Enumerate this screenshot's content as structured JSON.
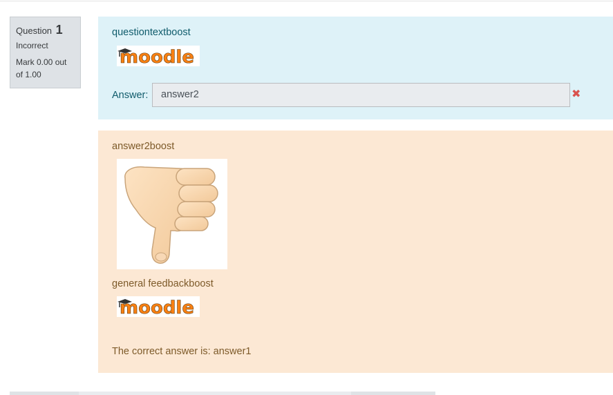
{
  "info": {
    "question_label": "Question",
    "question_number": "1",
    "state": "Incorrect",
    "grade": "Mark 0.00 out of 1.00"
  },
  "formulation": {
    "question_text": "questiontextboost",
    "logo_text": "moodle",
    "answer_label": "Answer:",
    "answer_value": "answer2",
    "mark_icon": "cross-icon"
  },
  "outcome": {
    "specific_feedback": "answer2boost",
    "image_icon": "thumbs-down-icon",
    "general_feedback": "general feedbackboost",
    "logo_text": "moodle",
    "right_answer": "The correct answer is: answer1"
  },
  "colors": {
    "formulation_bg": "#def2f8",
    "outcome_bg": "#fce8d4",
    "info_bg": "#dee2e6",
    "incorrect": "#d9534f",
    "moodle_orange": "#f98012"
  }
}
